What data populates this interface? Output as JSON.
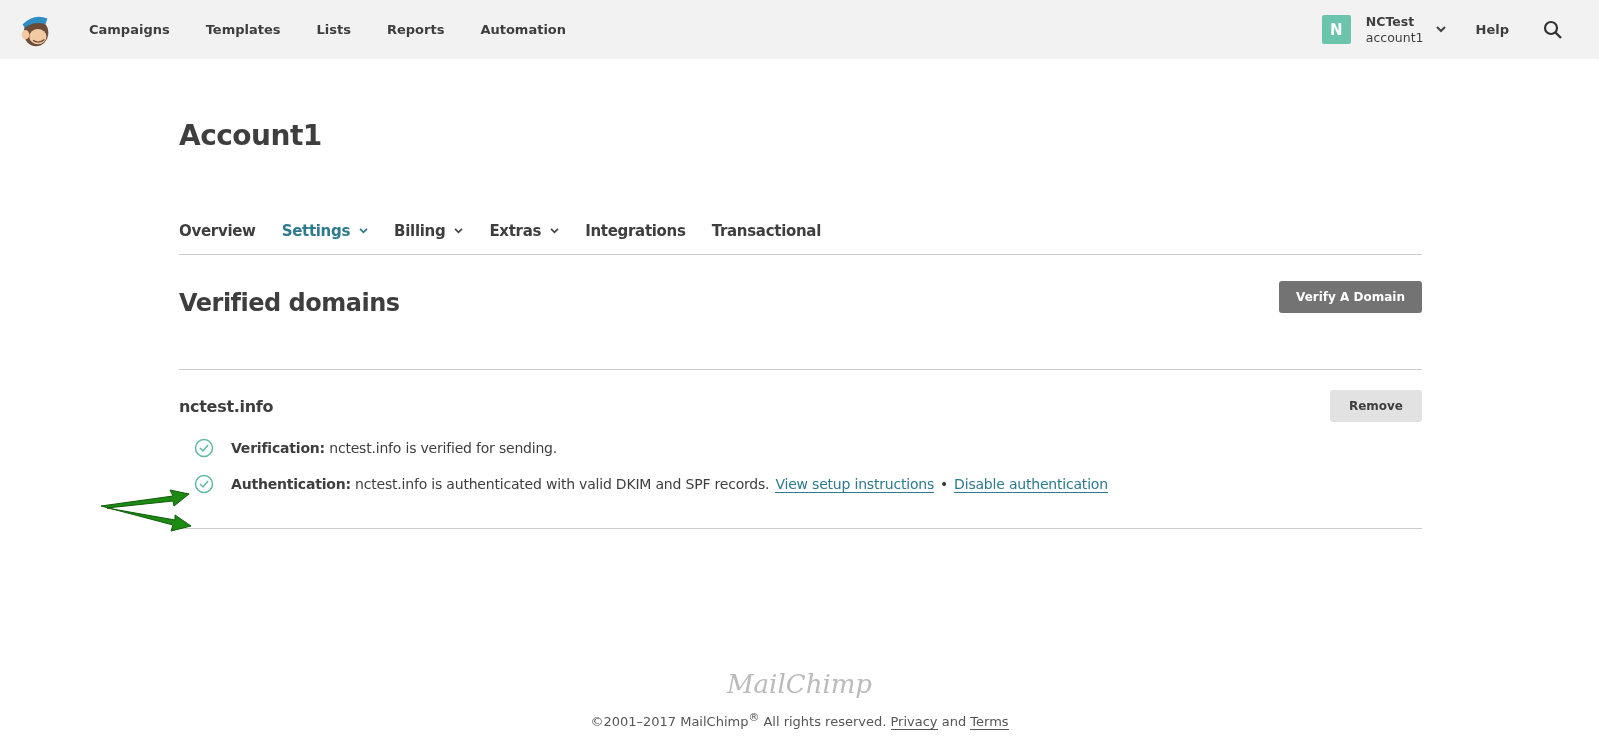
{
  "topbar": {
    "nav": [
      {
        "label": "Campaigns"
      },
      {
        "label": "Templates"
      },
      {
        "label": "Lists"
      },
      {
        "label": "Reports"
      },
      {
        "label": "Automation"
      }
    ],
    "account": {
      "initial": "N",
      "name": "NCTest",
      "sub": "account1"
    },
    "help": "Help"
  },
  "page": {
    "title": "Account1",
    "tabs": [
      {
        "label": "Overview",
        "selected": false,
        "dropdown": false
      },
      {
        "label": "Settings",
        "selected": true,
        "dropdown": true
      },
      {
        "label": "Billing",
        "selected": false,
        "dropdown": true
      },
      {
        "label": "Extras",
        "selected": false,
        "dropdown": true
      },
      {
        "label": "Integrations",
        "selected": false,
        "dropdown": false
      },
      {
        "label": "Transactional",
        "selected": false,
        "dropdown": false
      }
    ],
    "section_title": "Verified domains",
    "verify_button": "Verify A Domain",
    "domain": {
      "name": "nctest.info",
      "remove_button": "Remove",
      "statuses": [
        {
          "label": "Verification:",
          "text": "nctest.info is verified for sending.",
          "ok": true
        },
        {
          "label": "Authentication:",
          "text": "nctest.info is authenticated with valid DKIM and SPF records.",
          "ok": true,
          "links": [
            "View setup instructions",
            "Disable authentication"
          ],
          "separator": "•"
        }
      ]
    }
  },
  "footer": {
    "logo": "MailChimp",
    "copyright": "©2001–2017 MailChimp$^{®}$ All rights reserved.",
    "privacy": "Privacy",
    "joiner": "and",
    "terms": "Terms"
  }
}
